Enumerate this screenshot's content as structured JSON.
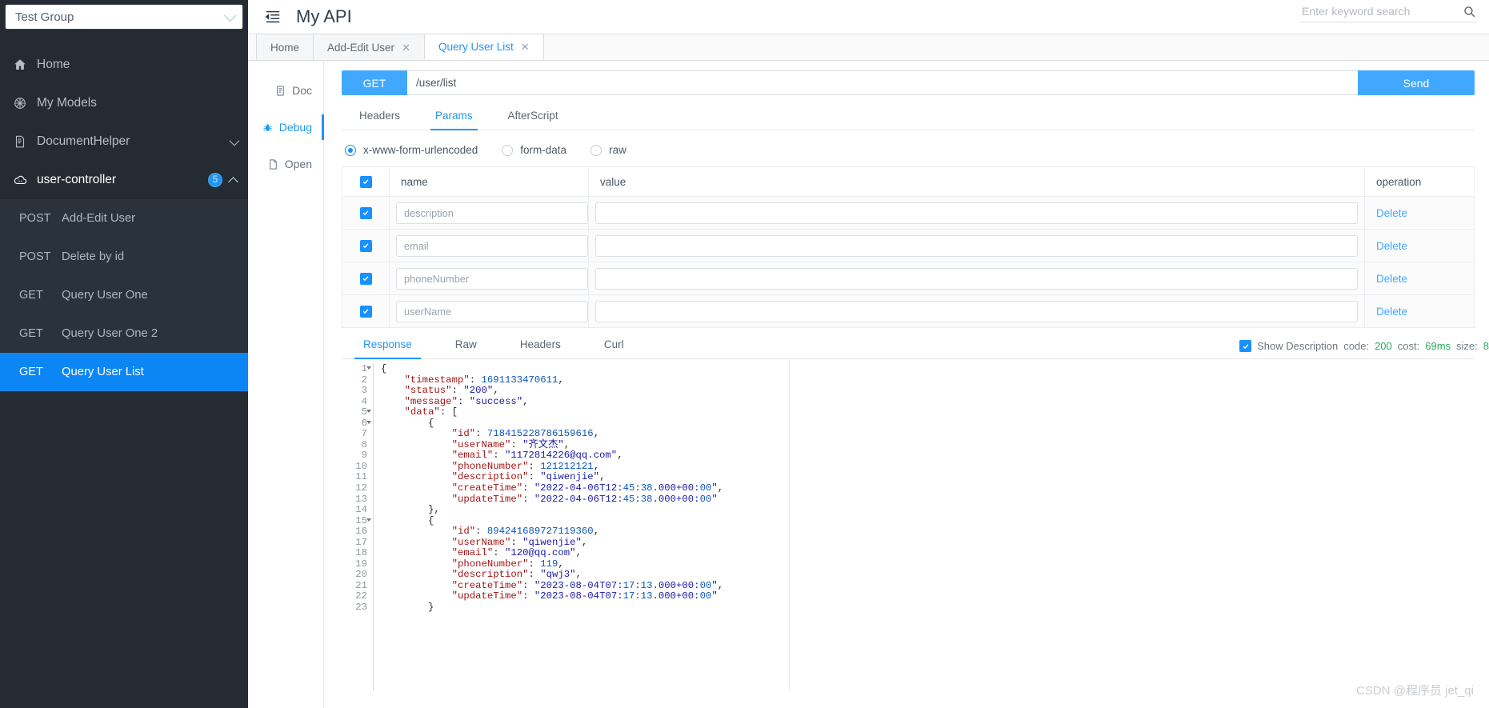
{
  "sidebar": {
    "group_select": {
      "value": "Test Group",
      "chevron_icon": "chevron-down-icon"
    },
    "nav": [
      {
        "label": "Home",
        "icon": "home-icon"
      },
      {
        "label": "My Models",
        "icon": "cube-icon"
      },
      {
        "label": "DocumentHelper",
        "icon": "document-icon",
        "chevron": "chevron-down-icon"
      },
      {
        "label": "user-controller",
        "icon": "cloud-icon",
        "badge": "5",
        "chevron": "chevron-up-icon"
      }
    ],
    "apis": [
      {
        "method": "POST",
        "name": "Add-Edit User",
        "active": false
      },
      {
        "method": "POST",
        "name": "Delete by id",
        "active": false
      },
      {
        "method": "GET",
        "name": "Query User One",
        "active": false
      },
      {
        "method": "GET",
        "name": "Query User One 2",
        "active": false
      },
      {
        "method": "GET",
        "name": "Query User List",
        "active": true
      }
    ]
  },
  "header": {
    "collapse_icon": "sidebar-collapse-icon",
    "title": "My API",
    "search": {
      "placeholder": "Enter keyword search",
      "value": "",
      "icon": "search-icon"
    }
  },
  "tabs": [
    {
      "label": "Home",
      "closable": false,
      "active": false
    },
    {
      "label": "Add-Edit User",
      "closable": true,
      "close": "✕",
      "active": false
    },
    {
      "label": "Query User List",
      "closable": true,
      "close": "✕",
      "active": true
    }
  ],
  "rail": [
    {
      "label": "Doc",
      "icon": "doc-icon",
      "active": false
    },
    {
      "label": "Debug",
      "icon": "bug-icon",
      "active": true
    },
    {
      "label": "Open",
      "icon": "open-file-icon",
      "active": false
    }
  ],
  "request": {
    "method": "GET",
    "url": "/user/list",
    "url_placeholder": "",
    "send_label": "Send",
    "tabs": [
      {
        "label": "Headers",
        "active": false
      },
      {
        "label": "Params",
        "active": true
      },
      {
        "label": "AfterScript",
        "active": false
      }
    ],
    "body_types": [
      {
        "label": "x-www-form-urlencoded",
        "selected": true
      },
      {
        "label": "form-data",
        "selected": false
      },
      {
        "label": "raw",
        "selected": false
      }
    ],
    "params_table": {
      "select_all": true,
      "columns": [
        "name",
        "value",
        "operation"
      ],
      "rows": [
        {
          "checked": true,
          "name": "description",
          "value": "",
          "operation": "Delete"
        },
        {
          "checked": true,
          "name": "email",
          "value": "",
          "operation": "Delete"
        },
        {
          "checked": true,
          "name": "phoneNumber",
          "value": "",
          "operation": "Delete"
        },
        {
          "checked": true,
          "name": "userName",
          "value": "",
          "operation": "Delete"
        }
      ]
    }
  },
  "response": {
    "tabs": [
      {
        "label": "Response",
        "active": true
      },
      {
        "label": "Raw",
        "active": false
      },
      {
        "label": "Headers",
        "active": false
      },
      {
        "label": "Curl",
        "active": false
      }
    ],
    "show_description": {
      "label": "Show Description",
      "checked": true
    },
    "meta": {
      "code_label": "code:",
      "code_value": "200",
      "cost_label": "cost:",
      "cost_value": "69ms",
      "size_label": "size:",
      "size_value": "8"
    },
    "body_lines": [
      {
        "n": 1,
        "fold": true,
        "text": "{"
      },
      {
        "n": 2,
        "fold": false,
        "text": "    \"timestamp\": 1691133470611,"
      },
      {
        "n": 3,
        "fold": false,
        "text": "    \"status\": \"200\","
      },
      {
        "n": 4,
        "fold": false,
        "text": "    \"message\": \"success\","
      },
      {
        "n": 5,
        "fold": true,
        "text": "    \"data\": ["
      },
      {
        "n": 6,
        "fold": true,
        "text": "        {"
      },
      {
        "n": 7,
        "fold": false,
        "text": "            \"id\": 718415228786159616,"
      },
      {
        "n": 8,
        "fold": false,
        "text": "            \"userName\": \"齐文杰\","
      },
      {
        "n": 9,
        "fold": false,
        "text": "            \"email\": \"1172814226@qq.com\","
      },
      {
        "n": 10,
        "fold": false,
        "text": "            \"phoneNumber\": 121212121,"
      },
      {
        "n": 11,
        "fold": false,
        "text": "            \"description\": \"qiwenjie\","
      },
      {
        "n": 12,
        "fold": false,
        "text": "            \"createTime\": \"2022-04-06T12:45:38.000+00:00\","
      },
      {
        "n": 13,
        "fold": false,
        "text": "            \"updateTime\": \"2022-04-06T12:45:38.000+00:00\""
      },
      {
        "n": 14,
        "fold": false,
        "text": "        },"
      },
      {
        "n": 15,
        "fold": true,
        "text": "        {"
      },
      {
        "n": 16,
        "fold": false,
        "text": "            \"id\": 894241689727119360,"
      },
      {
        "n": 17,
        "fold": false,
        "text": "            \"userName\": \"qiwenjie\","
      },
      {
        "n": 18,
        "fold": false,
        "text": "            \"email\": \"120@qq.com\","
      },
      {
        "n": 19,
        "fold": false,
        "text": "            \"phoneNumber\": 119,"
      },
      {
        "n": 20,
        "fold": false,
        "text": "            \"description\": \"qwj3\","
      },
      {
        "n": 21,
        "fold": false,
        "text": "            \"createTime\": \"2023-08-04T07:17:13.000+00:00\","
      },
      {
        "n": 22,
        "fold": false,
        "text": "            \"updateTime\": \"2023-08-04T07:17:13.000+00:00\""
      },
      {
        "n": 23,
        "fold": false,
        "text": "        }"
      }
    ]
  },
  "watermark": "CSDN @程序员 jet_qi"
}
